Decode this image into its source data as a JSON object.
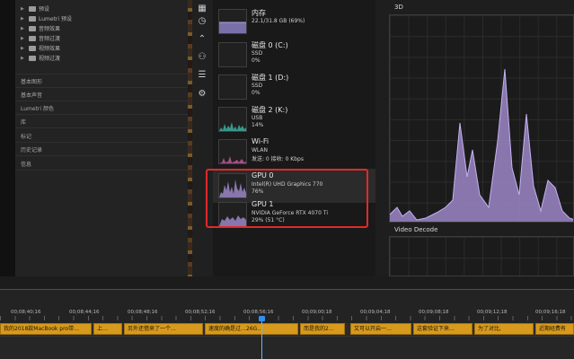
{
  "premiere": {
    "tree_items": [
      {
        "label": "预设"
      },
      {
        "label": "Lumetri 预设"
      },
      {
        "label": "音频效果"
      },
      {
        "label": "音频过渡"
      },
      {
        "label": "视频效果"
      },
      {
        "label": "视频过渡"
      }
    ],
    "panels": [
      "基本图形",
      "基本声音",
      "Lumetri 颜色",
      "库",
      "标记",
      "历史记录",
      "信息"
    ]
  },
  "taskmanager": {
    "rail_icons": [
      "processes-icon",
      "history-icon",
      "startup-icon",
      "users-icon",
      "details-icon",
      "services-icon"
    ],
    "resources": [
      {
        "name": "内存",
        "line1": "22.1/31.8 GB (69%)",
        "line2": ""
      },
      {
        "name": "磁盘 0 (C:)",
        "line1": "SSD",
        "line2": "0%"
      },
      {
        "name": "磁盘 1 (D:)",
        "line1": "SSD",
        "line2": "0%"
      },
      {
        "name": "磁盘 2 (K:)",
        "line1": "USB",
        "line2": "14%"
      },
      {
        "name": "Wi-Fi",
        "line1": "WLAN",
        "line2": "发送: 0 接收: 0 Kbps"
      },
      {
        "name": "GPU 0",
        "line1": "Intel(R) UHD Graphics 770",
        "line2": "76%"
      },
      {
        "name": "GPU 1",
        "line1": "NVIDIA GeForce RTX 4070 Ti",
        "line2": "29% (51 °C)"
      }
    ],
    "graph_3d_label": "3D",
    "graph_video_decode_label": "Video Decode",
    "colors": {
      "gpu_graph": "#9b86c7",
      "disk_graph": "#3fb6a8",
      "wifi_graph": "#c45aa0",
      "mem_graph": "#8a7fc2",
      "highlight": "#e02a2a"
    }
  },
  "timeline": {
    "timecodes": [
      "00;08;40;16",
      "00;08;44;16",
      "00;08;48;16",
      "00;08;52;16",
      "00;08;56;16",
      "00;09;00;18",
      "00;09;04;18",
      "00;09;08;18",
      "00;09;12;18",
      "00;09;16;18"
    ],
    "captions": [
      "我的2018款MacBook pro带…",
      "上…",
      "另外还借来了一个…",
      "速度的确是过…26G…",
      "而是我的2…",
      "又可以开启一…",
      "这套验证下来…",
      "为了对比,",
      "近期经费有"
    ]
  }
}
